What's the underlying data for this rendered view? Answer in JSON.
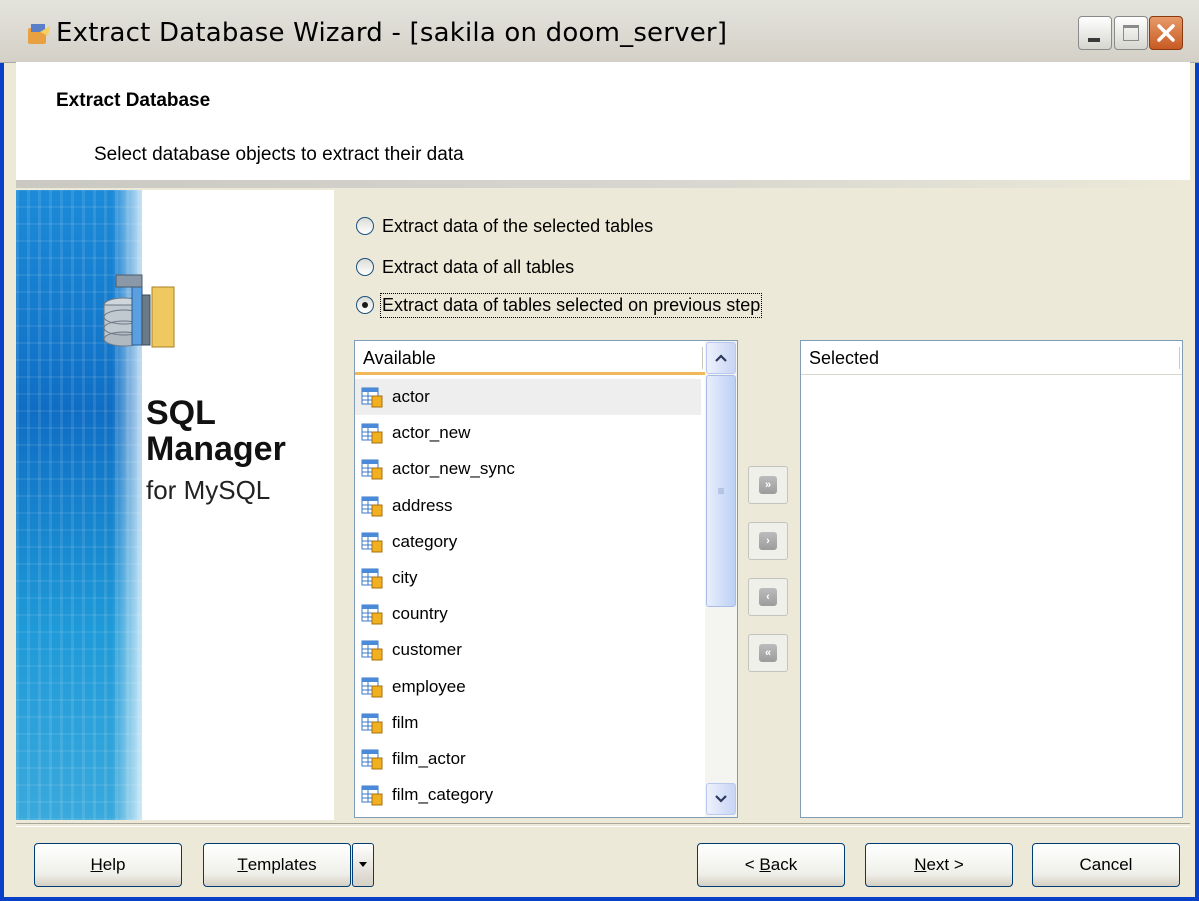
{
  "window": {
    "title": "Extract Database Wizard - [sakila on doom_server]"
  },
  "header": {
    "title": "Extract Database",
    "subtitle": "Select database objects to extract their data"
  },
  "banner": {
    "line1": "SQL",
    "line2": "Manager",
    "line3": "for MySQL"
  },
  "options": [
    {
      "label": "Extract data of the selected tables",
      "checked": false
    },
    {
      "label": "Extract data of all tables",
      "checked": false
    },
    {
      "label": "Extract data of tables selected on  previous step",
      "checked": true
    }
  ],
  "available": {
    "header": "Available",
    "items": [
      "actor",
      "actor_new",
      "actor_new_sync",
      "address",
      "category",
      "city",
      "country",
      "customer",
      "employee",
      "film",
      "film_actor",
      "film_category"
    ],
    "selected_index": 0
  },
  "selected": {
    "header": "Selected",
    "items": []
  },
  "move_buttons": [
    {
      "name": "move-all-right",
      "glyph": "»"
    },
    {
      "name": "move-right",
      "glyph": "›"
    },
    {
      "name": "move-left",
      "glyph": "‹"
    },
    {
      "name": "move-all-left",
      "glyph": "«"
    }
  ],
  "buttons": {
    "help": {
      "u": "H",
      "rest": "elp"
    },
    "templates": {
      "u": "T",
      "rest": "emplates"
    },
    "back": {
      "pre": "< ",
      "u": "B",
      "rest": "ack"
    },
    "next": {
      "u": "N",
      "rest": "ext >"
    },
    "cancel": "Cancel"
  },
  "icons": {
    "app": "wizard-app-icon",
    "table": "table-icon"
  },
  "colors": {
    "title_border": "#0a3fc8",
    "list_border": "#7f9db9",
    "header_accent": "#f0b858"
  }
}
